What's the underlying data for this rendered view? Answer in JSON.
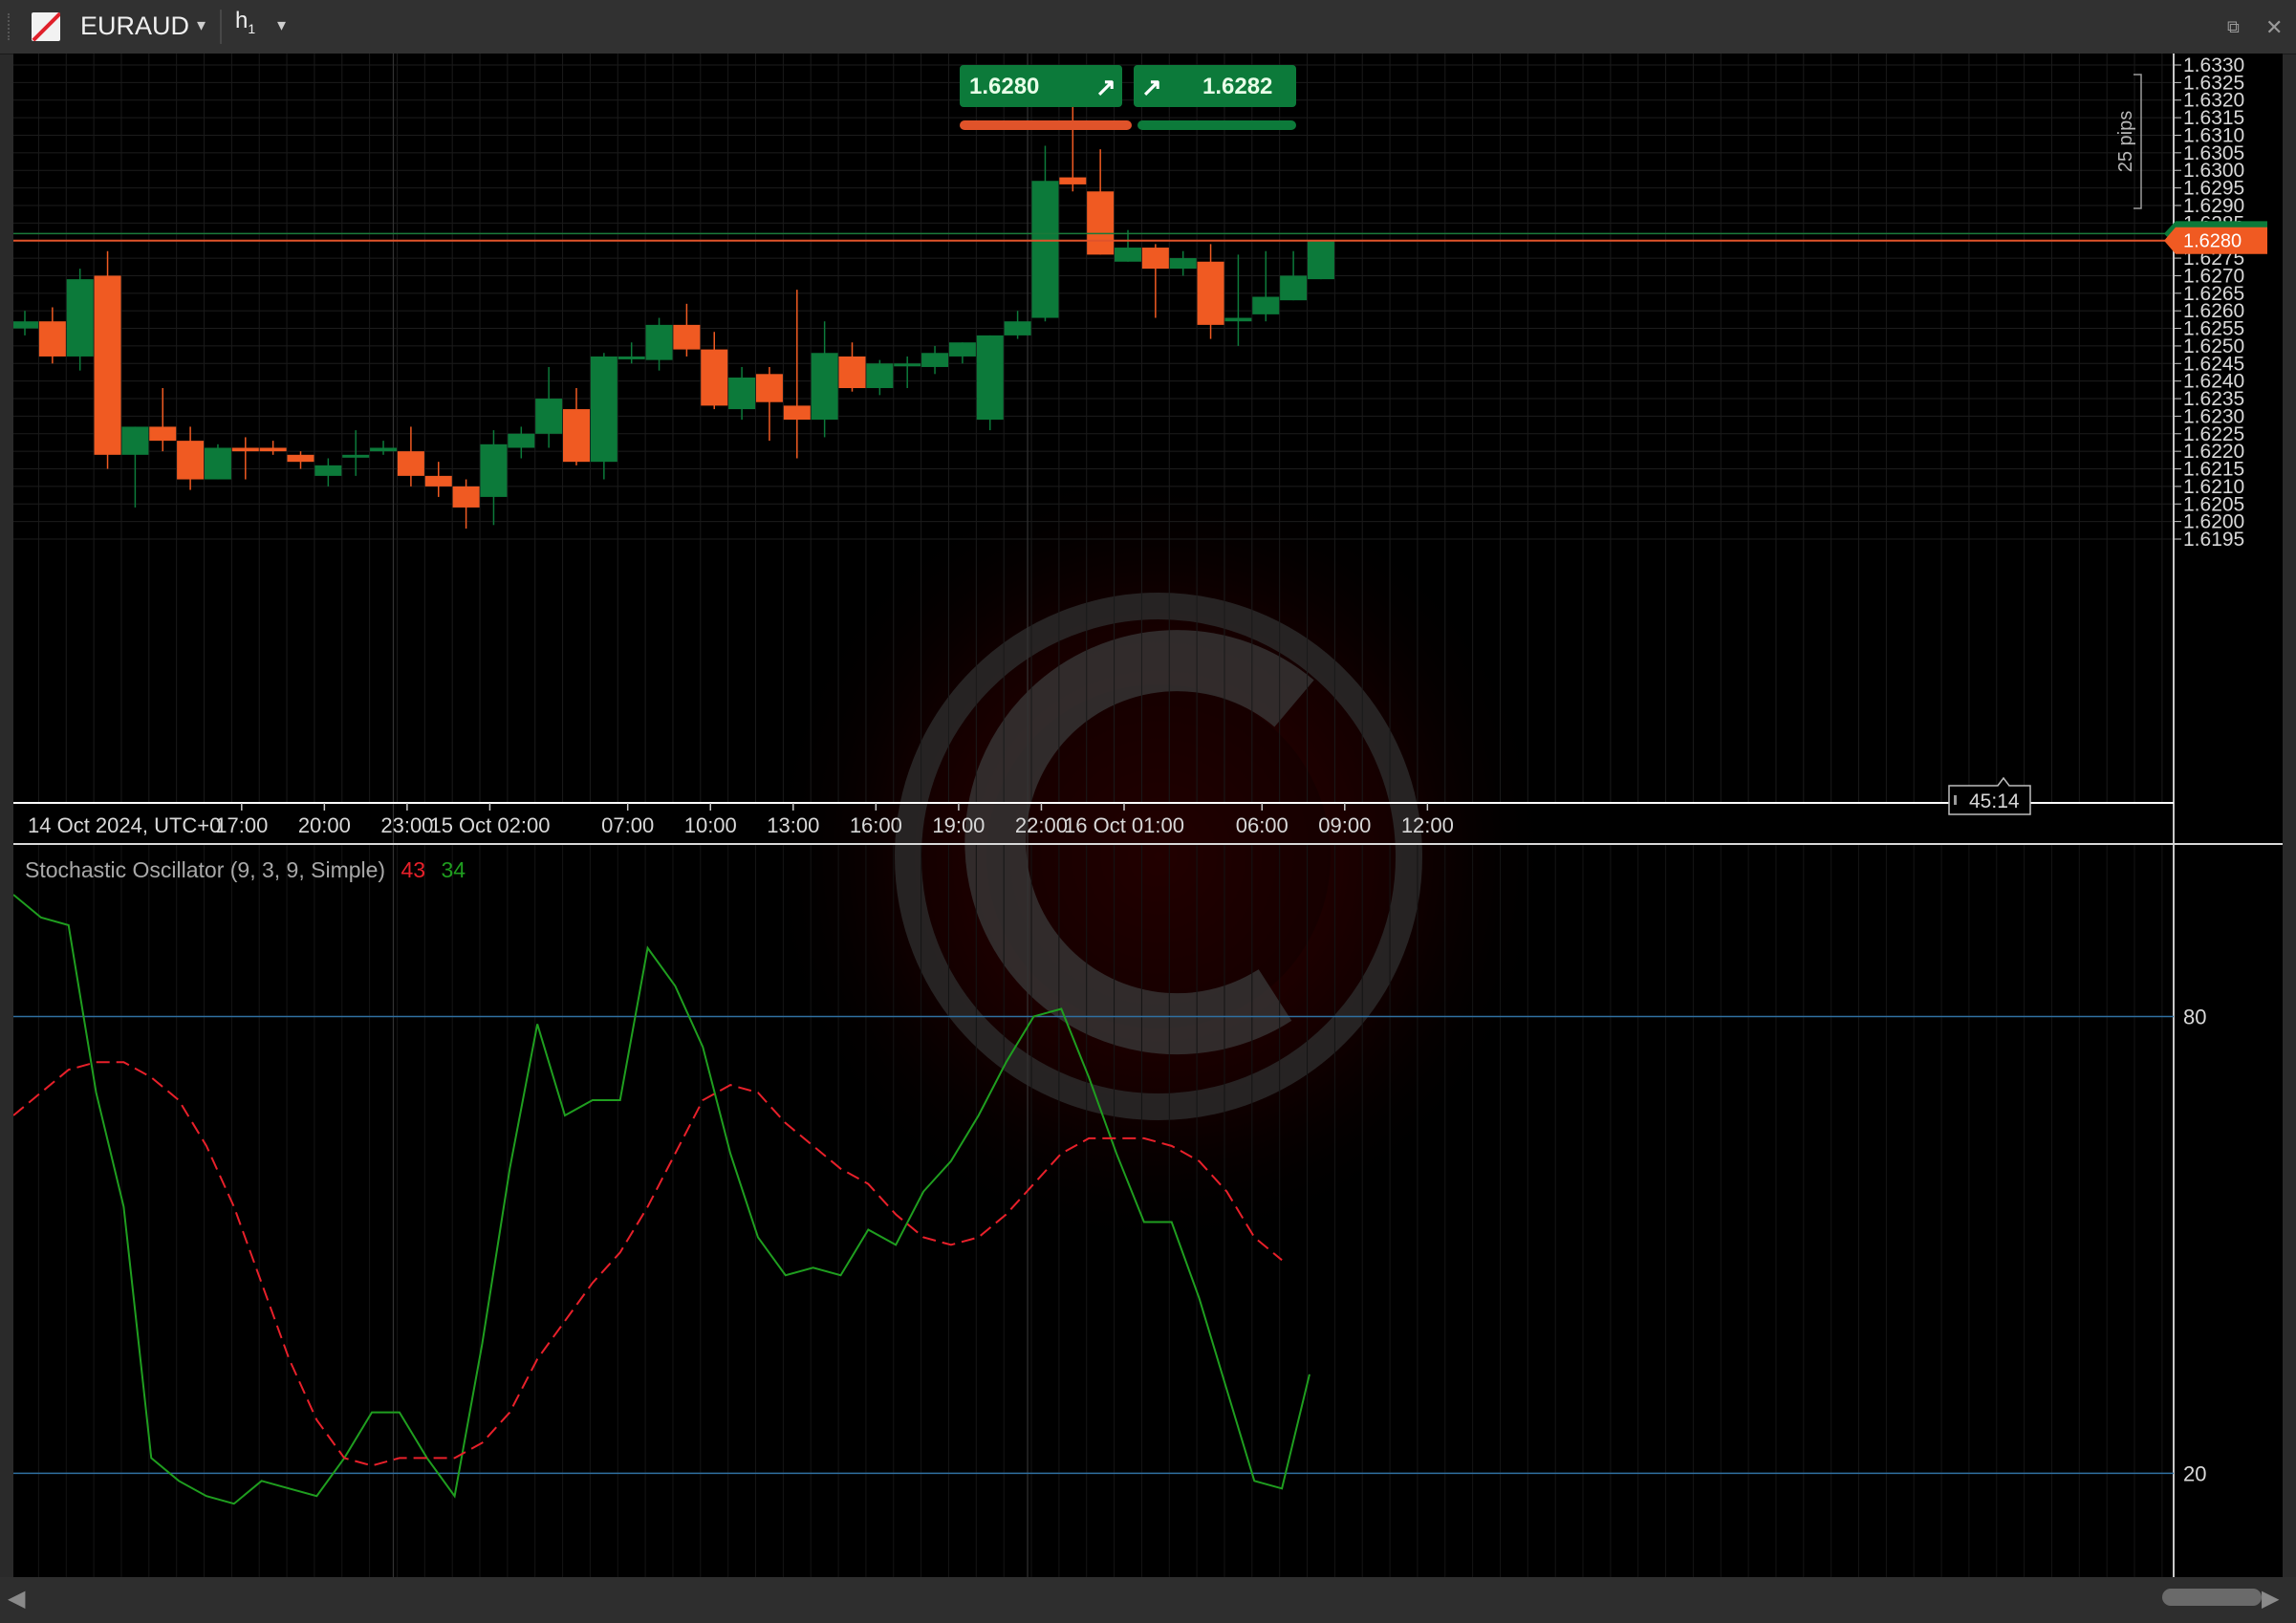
{
  "toolbar": {
    "symbol": "EURAUD",
    "dropdown": "▾",
    "timeframe": "h",
    "timeframe_sub": "1",
    "popout_icon": "⧉",
    "close_icon": "✕"
  },
  "quote": {
    "sell_price": "1.6280",
    "buy_price": "1.6282",
    "sell_color": "#e0532a",
    "buy_color": "#0c7a3a"
  },
  "pips_label": "25 pips",
  "current_price": "1.6280",
  "countdown": "45:14",
  "price_axis": [
    "1.6330",
    "1.6325",
    "1.6320",
    "1.6315",
    "1.6310",
    "1.6305",
    "1.6300",
    "1.6295",
    "1.6290",
    "1.6285",
    "1.6280",
    "1.6275",
    "1.6270",
    "1.6265",
    "1.6260",
    "1.6255",
    "1.6250",
    "1.6245",
    "1.6240",
    "1.6235",
    "1.6230",
    "1.6225",
    "1.6220",
    "1.6215",
    "1.6210",
    "1.6205",
    "1.6200",
    "1.6195"
  ],
  "time_axis": [
    {
      "label": "14 Oct 2024, UTC+0",
      "hour": -0.7
    },
    {
      "label": "17:00",
      "hour": 8
    },
    {
      "label": "20:00",
      "hour": 11
    },
    {
      "label": "23:00",
      "hour": 14
    },
    {
      "label": "15 Oct 02:00",
      "hour": 17
    },
    {
      "label": "07:00",
      "hour": 22
    },
    {
      "label": "10:00",
      "hour": 25
    },
    {
      "label": "13:00",
      "hour": 28
    },
    {
      "label": "16:00",
      "hour": 31
    },
    {
      "label": "19:00",
      "hour": 34
    },
    {
      "label": "22:00",
      "hour": 37
    },
    {
      "label": "16 Oct 01:00",
      "hour": 40
    },
    {
      "label": "06:00",
      "hour": 45
    },
    {
      "label": "09:00",
      "hour": 48
    },
    {
      "label": "12:00",
      "hour": 51
    }
  ],
  "indicator": {
    "label": "Stochastic Oscillator (9, 3, 9, Simple)",
    "k_value": "43",
    "d_value": "34",
    "levels": [
      "80",
      "20"
    ],
    "d_color": "#e8202a",
    "k_color": "#1f9e1f"
  },
  "chart_data": [
    {
      "type": "candlestick",
      "symbol": "EURAUD",
      "timeframe": "h1",
      "ylim": [
        1.6193,
        1.6333
      ],
      "up_color": "#0c7a3a",
      "down_color": "#f05a22",
      "candles": [
        {
          "o": 1.6255,
          "h": 1.626,
          "l": 1.6253,
          "c": 1.6257
        },
        {
          "o": 1.6257,
          "h": 1.6261,
          "l": 1.6245,
          "c": 1.6247
        },
        {
          "o": 1.6247,
          "h": 1.6272,
          "l": 1.6243,
          "c": 1.6269
        },
        {
          "o": 1.627,
          "h": 1.6277,
          "l": 1.6215,
          "c": 1.6219
        },
        {
          "o": 1.6219,
          "h": 1.6227,
          "l": 1.6204,
          "c": 1.6227
        },
        {
          "o": 1.6227,
          "h": 1.6238,
          "l": 1.622,
          "c": 1.6223
        },
        {
          "o": 1.6223,
          "h": 1.6227,
          "l": 1.6209,
          "c": 1.6212
        },
        {
          "o": 1.6212,
          "h": 1.6222,
          "l": 1.6212,
          "c": 1.6221
        },
        {
          "o": 1.6221,
          "h": 1.6224,
          "l": 1.6212,
          "c": 1.622
        },
        {
          "o": 1.6221,
          "h": 1.6223,
          "l": 1.6219,
          "c": 1.622
        },
        {
          "o": 1.6219,
          "h": 1.622,
          "l": 1.6215,
          "c": 1.6217
        },
        {
          "o": 1.6213,
          "h": 1.6218,
          "l": 1.621,
          "c": 1.6216
        },
        {
          "o": 1.6219,
          "h": 1.6226,
          "l": 1.6213,
          "c": 1.6219
        },
        {
          "o": 1.622,
          "h": 1.6223,
          "l": 1.6219,
          "c": 1.6221
        },
        {
          "o": 1.622,
          "h": 1.6227,
          "l": 1.621,
          "c": 1.6213
        },
        {
          "o": 1.6213,
          "h": 1.6217,
          "l": 1.6207,
          "c": 1.621
        },
        {
          "o": 1.621,
          "h": 1.6212,
          "l": 1.6198,
          "c": 1.6204
        },
        {
          "o": 1.6207,
          "h": 1.6226,
          "l": 1.6199,
          "c": 1.6222
        },
        {
          "o": 1.6221,
          "h": 1.6227,
          "l": 1.6218,
          "c": 1.6225
        },
        {
          "o": 1.6225,
          "h": 1.6244,
          "l": 1.6221,
          "c": 1.6235
        },
        {
          "o": 1.6232,
          "h": 1.6238,
          "l": 1.6216,
          "c": 1.6217
        },
        {
          "o": 1.6217,
          "h": 1.6248,
          "l": 1.6212,
          "c": 1.6247
        },
        {
          "o": 1.6247,
          "h": 1.6251,
          "l": 1.6245,
          "c": 1.6247
        },
        {
          "o": 1.6246,
          "h": 1.6258,
          "l": 1.6243,
          "c": 1.6256
        },
        {
          "o": 1.6256,
          "h": 1.6262,
          "l": 1.6247,
          "c": 1.6249
        },
        {
          "o": 1.6249,
          "h": 1.6254,
          "l": 1.6232,
          "c": 1.6233
        },
        {
          "o": 1.6232,
          "h": 1.6244,
          "l": 1.6229,
          "c": 1.6241
        },
        {
          "o": 1.6242,
          "h": 1.6244,
          "l": 1.6223,
          "c": 1.6234
        },
        {
          "o": 1.6233,
          "h": 1.6266,
          "l": 1.6218,
          "c": 1.6229
        },
        {
          "o": 1.6229,
          "h": 1.6257,
          "l": 1.6224,
          "c": 1.6248
        },
        {
          "o": 1.6247,
          "h": 1.6251,
          "l": 1.6237,
          "c": 1.6238
        },
        {
          "o": 1.6238,
          "h": 1.6246,
          "l": 1.6236,
          "c": 1.6245
        },
        {
          "o": 1.6245,
          "h": 1.6247,
          "l": 1.6238,
          "c": 1.6245
        },
        {
          "o": 1.6244,
          "h": 1.625,
          "l": 1.6242,
          "c": 1.6248
        },
        {
          "o": 1.6247,
          "h": 1.6251,
          "l": 1.6245,
          "c": 1.6251
        },
        {
          "o": 1.6229,
          "h": 1.6253,
          "l": 1.6226,
          "c": 1.6253
        },
        {
          "o": 1.6253,
          "h": 1.626,
          "l": 1.6252,
          "c": 1.6257
        },
        {
          "o": 1.6258,
          "h": 1.6307,
          "l": 1.6257,
          "c": 1.6297
        },
        {
          "o": 1.6298,
          "h": 1.632,
          "l": 1.6294,
          "c": 1.6296
        },
        {
          "o": 1.6294,
          "h": 1.6306,
          "l": 1.6276,
          "c": 1.6276
        },
        {
          "o": 1.6274,
          "h": 1.6283,
          "l": 1.6274,
          "c": 1.6278
        },
        {
          "o": 1.6278,
          "h": 1.6279,
          "l": 1.6258,
          "c": 1.6272
        },
        {
          "o": 1.6272,
          "h": 1.6277,
          "l": 1.627,
          "c": 1.6275
        },
        {
          "o": 1.6274,
          "h": 1.6279,
          "l": 1.6252,
          "c": 1.6256
        },
        {
          "o": 1.6257,
          "h": 1.6276,
          "l": 1.625,
          "c": 1.6258
        },
        {
          "o": 1.6259,
          "h": 1.6277,
          "l": 1.6257,
          "c": 1.6264
        },
        {
          "o": 1.6263,
          "h": 1.6277,
          "l": 1.6263,
          "c": 1.627
        },
        {
          "o": 1.6269,
          "h": 1.628,
          "l": 1.6269,
          "c": 1.628
        }
      ]
    },
    {
      "type": "line",
      "title": "Stochastic Oscillator (9, 3, 9, Simple)",
      "ylim": [
        10,
        96
      ],
      "levels": [
        80,
        20
      ],
      "series": [
        {
          "values": [
            96,
            93,
            92,
            70,
            55,
            22,
            19,
            17,
            16,
            19,
            18,
            17,
            22,
            28,
            28,
            22,
            17,
            37,
            60,
            79,
            67,
            69,
            69,
            89,
            84,
            76,
            62,
            51,
            46,
            47,
            46,
            52,
            50,
            57,
            61,
            67,
            74,
            80,
            81,
            72,
            62,
            53,
            53,
            43,
            31,
            19,
            18,
            33
          ]
        },
        {
          "values": [
            67,
            70,
            73,
            74,
            74,
            72,
            69,
            63,
            55,
            45,
            35,
            27,
            22,
            21,
            22,
            22,
            22,
            24,
            28,
            35,
            40,
            45,
            49,
            55,
            62,
            69,
            71,
            70,
            66,
            63,
            60,
            58,
            54,
            51,
            50,
            51,
            54,
            58,
            62,
            64,
            64,
            64,
            63,
            61,
            57,
            51,
            48
          ]
        }
      ]
    }
  ]
}
